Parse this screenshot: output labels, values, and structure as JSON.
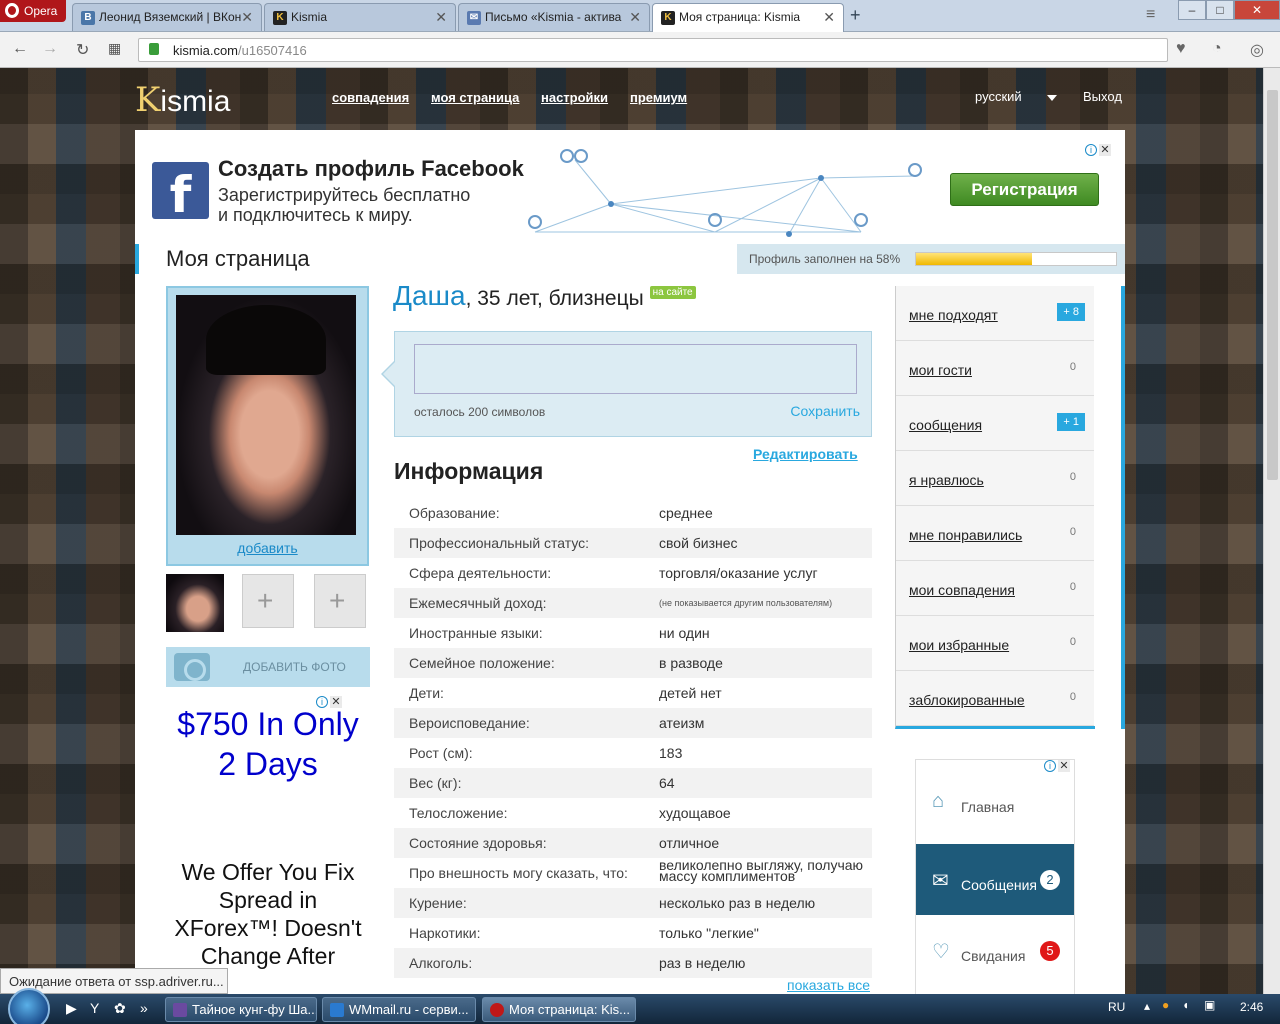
{
  "browser": {
    "menu_label": "Opera",
    "tabs": [
      {
        "label": "Леонид Вяземский | ВКон",
        "icon": "vk-icon",
        "color": "#4a76a8"
      },
      {
        "label": "Kismia",
        "icon": "kismia-icon",
        "color": "#222222"
      },
      {
        "label": "Письмо «Kismia - актива",
        "icon": "mail-icon",
        "color": "#5a7ab0"
      },
      {
        "label": "Моя страница: Kismia",
        "icon": "kismia-icon",
        "color": "#222222"
      }
    ],
    "url_domain": "kismia.com",
    "url_path": "/u16507416"
  },
  "site": {
    "logo_k": "K",
    "logo_rest": "ismia",
    "nav": [
      "совпадения",
      "моя страница",
      "настройки",
      "премиум"
    ],
    "language": "русский",
    "logout": "Выход"
  },
  "fb_ad": {
    "title": "Создать профиль Facebook",
    "sub1": "Зарегистрируйтесь бесплатно",
    "sub2": "и подключитесь к миру.",
    "button": "Регистрация",
    "logo_letter": "f"
  },
  "page": {
    "title": "Моя страница",
    "progress_label": "Профиль заполнен на 58%",
    "progress_value": 58
  },
  "photo": {
    "add_link": "добавить",
    "add_photo": "ДОБАВИТЬ ФОТО"
  },
  "left_ad": {
    "headline": "$750 In Only 2 Days",
    "body": "We Offer You Fix Spread in XForex™! Doesn't Change After"
  },
  "profile": {
    "name": "Даша",
    "details": ", 35 лет, близнецы",
    "online_badge": "на сайте",
    "status_left": "осталось 200 символов",
    "status_save": "Сохранить",
    "edit": "Редактировать",
    "info_title": "Информация",
    "info": [
      {
        "k": "Образование:",
        "v": "среднее"
      },
      {
        "k": "Профессиональный статус:",
        "v": "свой бизнес"
      },
      {
        "k": "Сфера деятельности:",
        "v": "торговля/оказание услуг"
      },
      {
        "k": "Ежемесячный доход:",
        "v": "(не показывается другим пользователям)"
      },
      {
        "k": "Иностранные языки:",
        "v": "ни один"
      },
      {
        "k": "Семейное положение:",
        "v": "в разводе"
      },
      {
        "k": "Дети:",
        "v": "детей нет"
      },
      {
        "k": "Вероисповедание:",
        "v": "атеизм"
      },
      {
        "k": "Рост (см):",
        "v": "183"
      },
      {
        "k": "Вес (кг):",
        "v": "64"
      },
      {
        "k": "Телосложение:",
        "v": "худощавое"
      },
      {
        "k": "Состояние здоровья:",
        "v": "отличное"
      },
      {
        "k": "Про внешность могу сказать, что:",
        "v": "великолепно выгляжу, получаю массу комплиментов"
      },
      {
        "k": "Курение:",
        "v": "несколько раз в неделю"
      },
      {
        "k": "Наркотики:",
        "v": "только \"легкие\""
      },
      {
        "k": "Алкоголь:",
        "v": "раз в неделю"
      }
    ],
    "show_all": "показать все"
  },
  "right_menu": [
    {
      "label": "мне подходят",
      "badge": "+ 8"
    },
    {
      "label": "мои гости",
      "count": "0"
    },
    {
      "label": "сообщения",
      "badge": "+ 1"
    },
    {
      "label": "я нравлюсь",
      "count": "0"
    },
    {
      "label": "мне понравились",
      "count": "0"
    },
    {
      "label": "мои совпадения",
      "count": "0"
    },
    {
      "label": "мои избранные",
      "count": "0"
    },
    {
      "label": "заблокированные",
      "count": "0"
    }
  ],
  "widget": {
    "home": "Главная",
    "messages": "Сообщения",
    "messages_count": "2",
    "dates": "Свидания",
    "dates_count": "5"
  },
  "status_bar": "Ожидание ответа от ssp.adriver.ru...",
  "taskbar": {
    "tasks": [
      "Тайное кунг-фу Ша...",
      "WMmail.ru - серви...",
      "Моя страница: Kis..."
    ],
    "lang": "RU",
    "time": "2:46"
  }
}
